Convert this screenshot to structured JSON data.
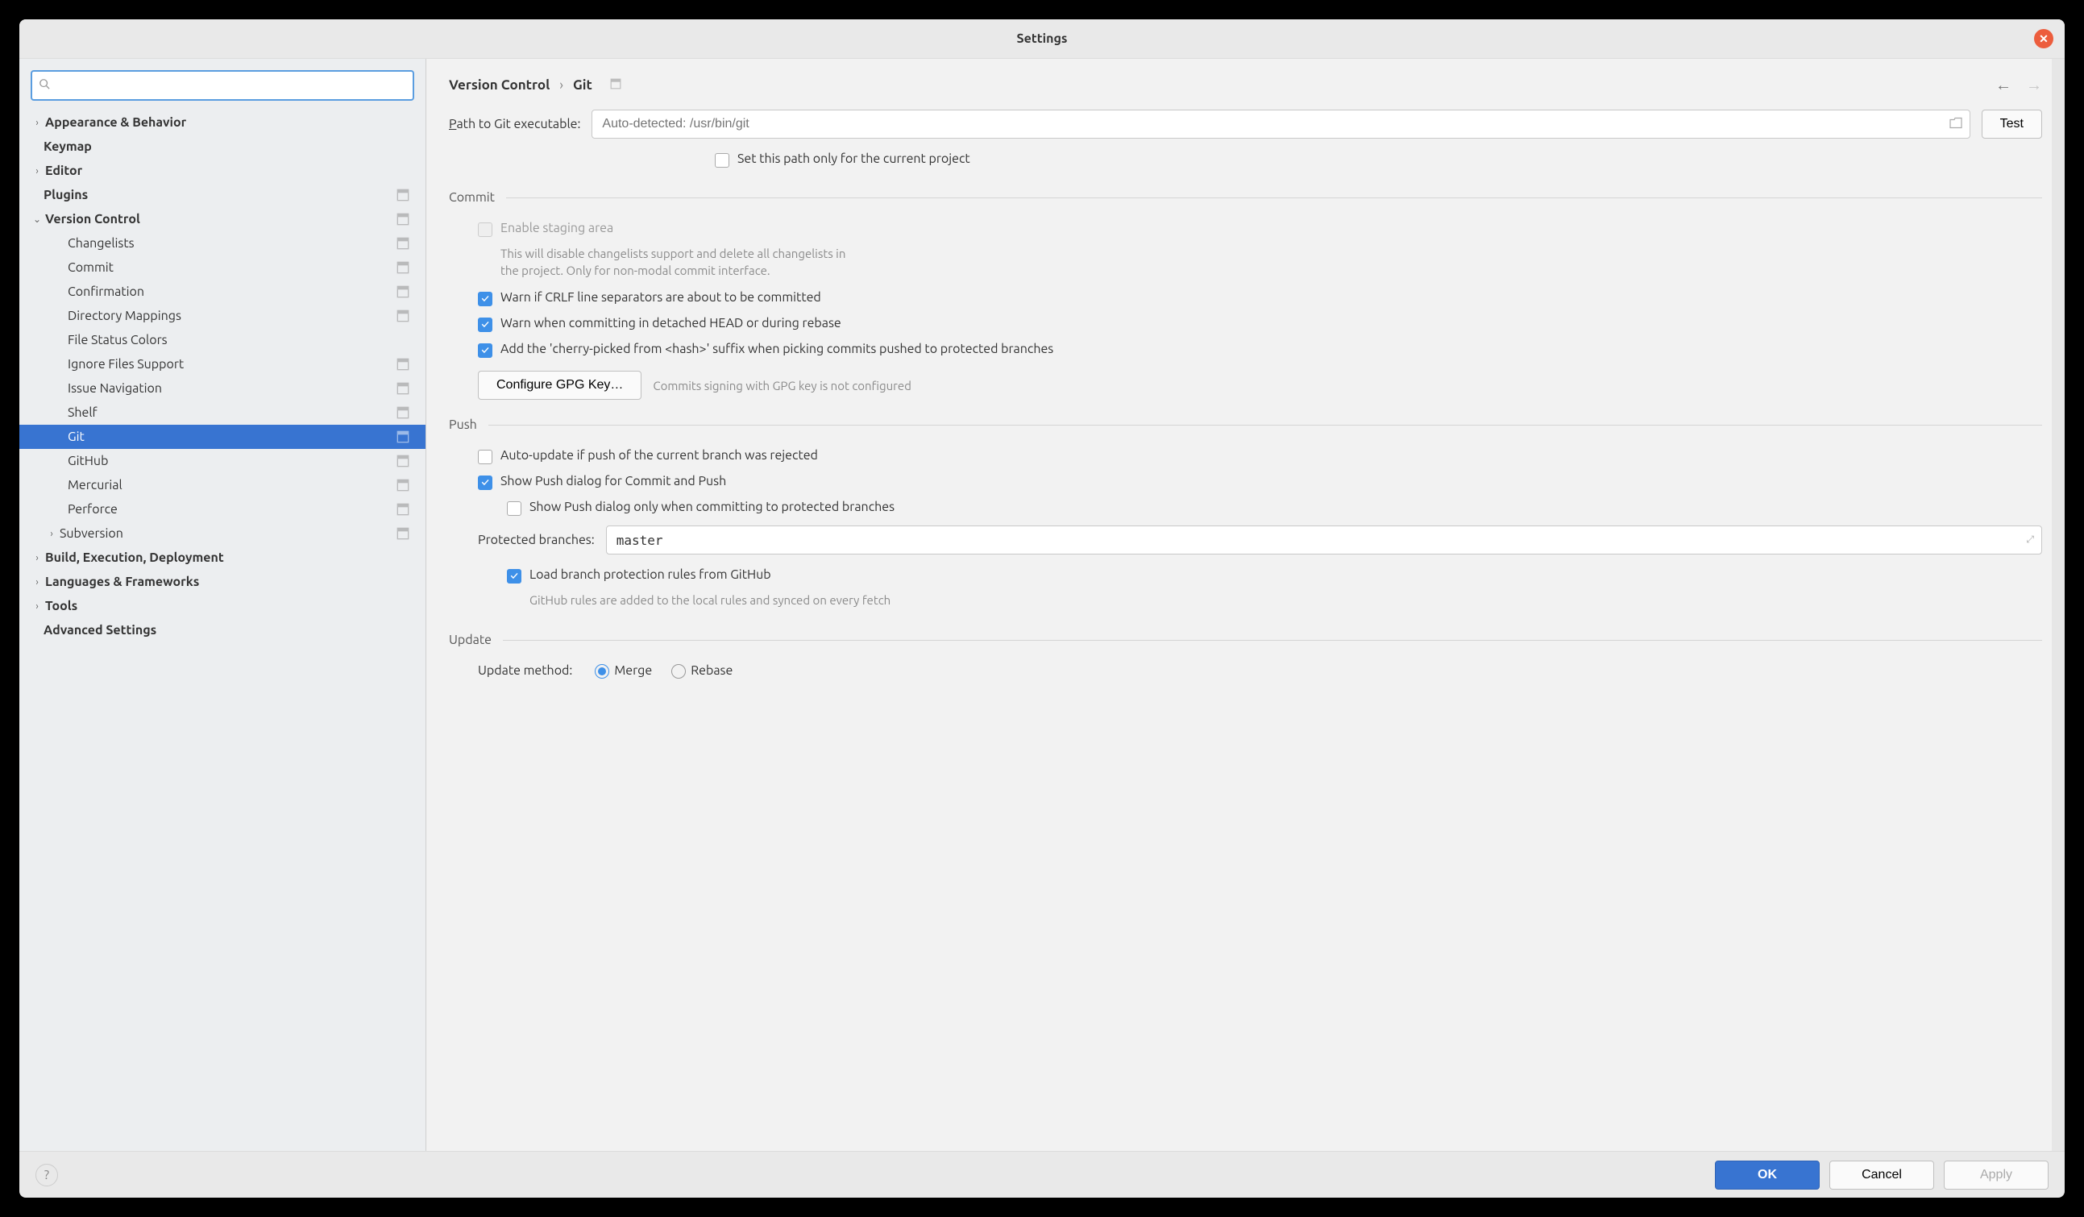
{
  "window": {
    "title": "Settings"
  },
  "search": {
    "placeholder": ""
  },
  "tree": {
    "appearance": "Appearance & Behavior",
    "keymap": "Keymap",
    "editor": "Editor",
    "plugins": "Plugins",
    "vcs": "Version Control",
    "vcs_children": {
      "changelists": "Changelists",
      "commit": "Commit",
      "confirmation": "Confirmation",
      "directory_mappings": "Directory Mappings",
      "file_status_colors": "File Status Colors",
      "ignore_files": "Ignore Files Support",
      "issue_navigation": "Issue Navigation",
      "shelf": "Shelf",
      "git": "Git",
      "github": "GitHub",
      "mercurial": "Mercurial",
      "perforce": "Perforce",
      "subversion": "Subversion"
    },
    "build": "Build, Execution, Deployment",
    "languages": "Languages & Frameworks",
    "tools": "Tools",
    "advanced": "Advanced Settings"
  },
  "breadcrumb": {
    "root": "Version Control",
    "leaf": "Git"
  },
  "git": {
    "path_label": "Path to Git executable:",
    "path_placeholder": "Auto-detected: /usr/bin/git",
    "test_btn": "Test",
    "set_path_project": "Set this path only for the current project",
    "sections": {
      "commit": "Commit",
      "push": "Push",
      "update": "Update"
    },
    "commit": {
      "enable_staging": "Enable staging area",
      "enable_staging_hint1": "This will disable changelists support and delete all changelists in",
      "enable_staging_hint2": "the project. Only for non-modal commit interface.",
      "warn_crlf": "Warn if CRLF line separators are about to be committed",
      "warn_detached": "Warn when committing in detached HEAD or during rebase",
      "cherry_suffix": "Add the 'cherry-picked from <hash>' suffix when picking commits pushed to protected branches",
      "gpg_btn": "Configure GPG Key…",
      "gpg_hint": "Commits signing with GPG key is not configured"
    },
    "push": {
      "auto_update": "Auto-update if push of the current branch was rejected",
      "show_push_dialog": "Show Push dialog for Commit and Push",
      "show_push_protected": "Show Push dialog only when committing to protected branches",
      "protected_label": "Protected branches:",
      "protected_value": "master",
      "load_github": "Load branch protection rules from GitHub",
      "github_hint": "GitHub rules are added to the local rules and synced on every fetch"
    },
    "update": {
      "method_label": "Update method:",
      "merge": "Merge",
      "rebase": "Rebase"
    }
  },
  "footer": {
    "ok": "OK",
    "cancel": "Cancel",
    "apply": "Apply"
  }
}
